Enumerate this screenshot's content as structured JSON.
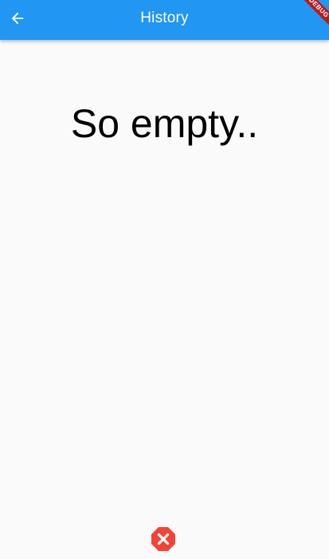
{
  "app_bar": {
    "title": "History",
    "back_icon": "arrow-back-icon",
    "background_color": "#2196f3",
    "text_color": "#ffffff"
  },
  "debug_banner": {
    "label": "DEBUG",
    "color": "#b71c1c"
  },
  "body": {
    "empty_message": "So empty..",
    "background_color": "#fafafa"
  },
  "error_indicator": {
    "icon": "error-octagon-icon",
    "color": "#f44336"
  }
}
